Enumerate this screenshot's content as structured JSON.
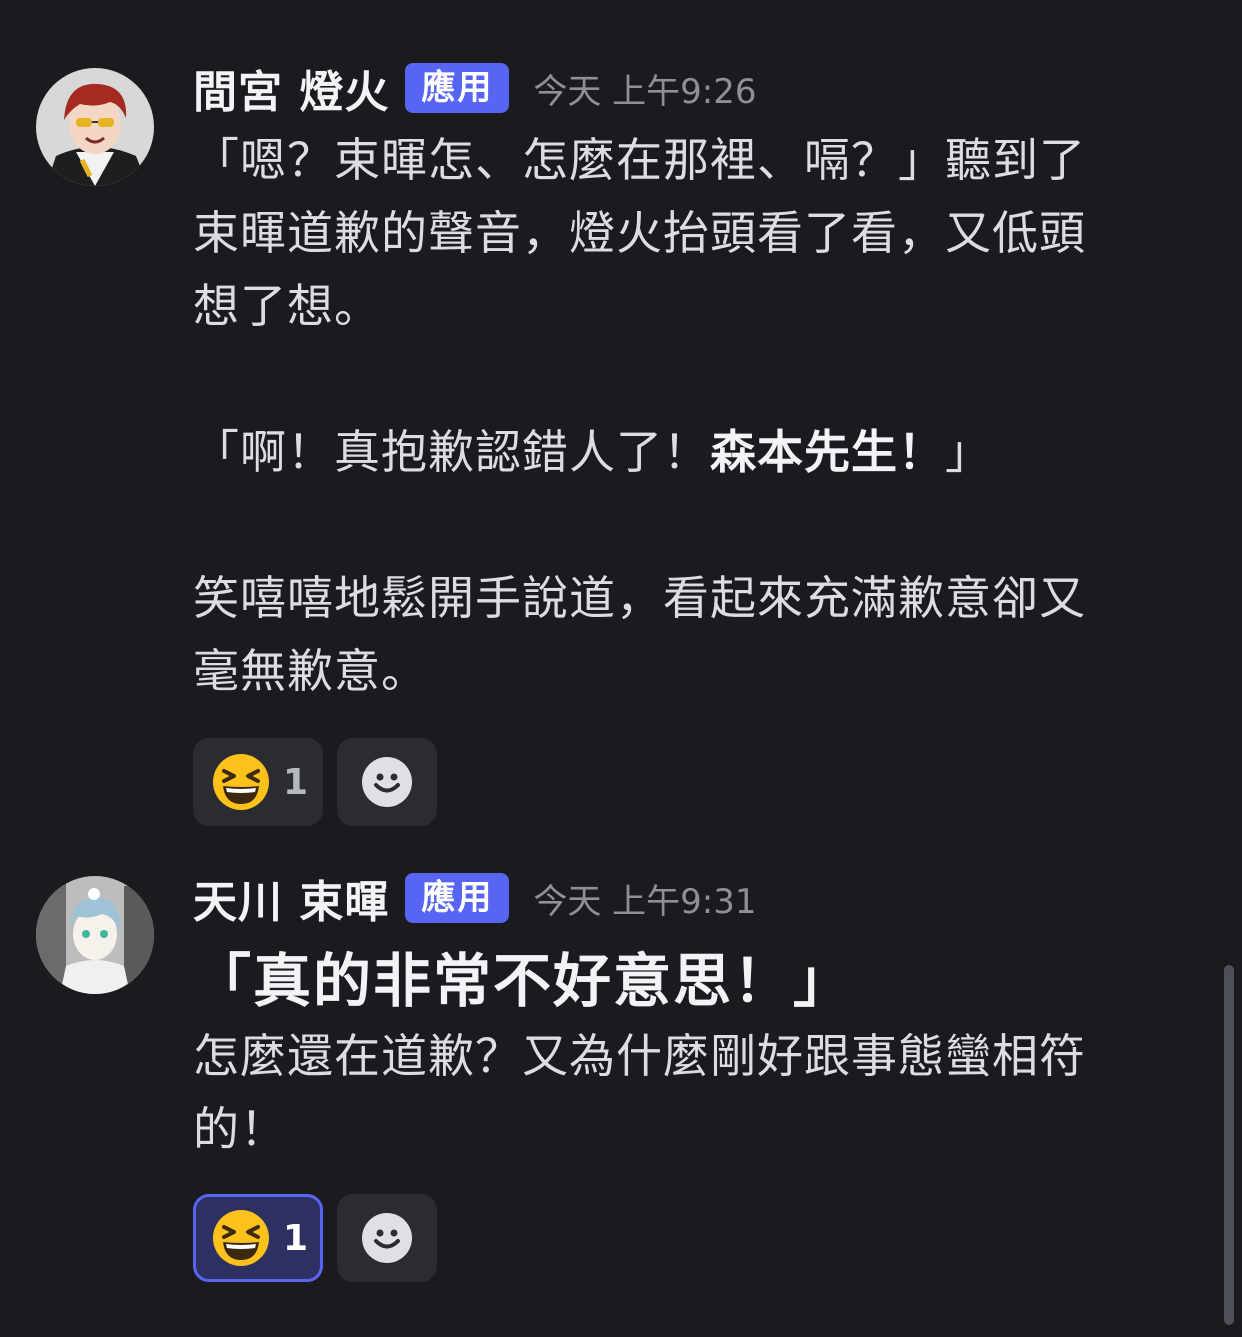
{
  "messages": [
    {
      "username": "間宮 燈火",
      "badge": "應用",
      "timestamp": "今天 上午9:26",
      "lines": [
        "「嗯？束暉怎、怎麼在那裡、嗝？」聽到了",
        "束暉道歉的聲音，燈火抬頭看了看，又低頭",
        "想了想。"
      ],
      "quote_before": "「啊！真抱歉認錯人了！",
      "quote_bold": "森本先生！",
      "quote_after": "」",
      "lines2": [
        "笑嘻嘻地鬆開手說道，看起來充滿歉意卻又",
        "毫無歉意。"
      ],
      "reaction": {
        "emoji": "laughing-face",
        "count": "1",
        "active": false
      }
    },
    {
      "username": "天川 束暉",
      "badge": "應用",
      "timestamp": "今天 上午9:31",
      "heading": "「真的非常不好意思！」",
      "lines": [
        "怎麼還在道歉？又為什麼剛好跟事態蠻相符",
        "的！"
      ],
      "reaction": {
        "emoji": "laughing-face",
        "count": "1",
        "active": true
      }
    }
  ],
  "colors": {
    "background": "#1b1b1f",
    "badge": "#5865f2",
    "reaction_active_border": "#5865f2"
  }
}
